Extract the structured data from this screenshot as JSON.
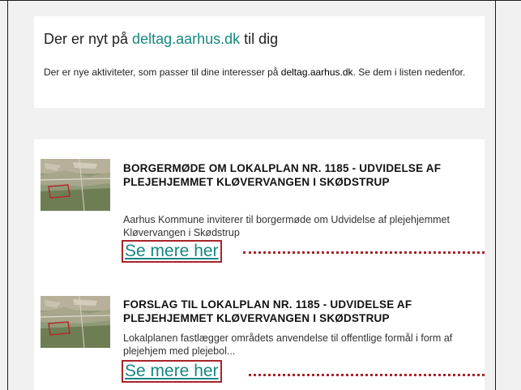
{
  "intro": {
    "title_prefix": "Der er nyt på ",
    "title_link": "deltag.aarhus.dk",
    "title_suffix": " til dig",
    "text_before": "Der er nye aktiviteter, som passer til dine interesser på ",
    "text_bold": "deltag.aarhus.dk",
    "text_after": ". Se dem i listen nedenfor."
  },
  "items": [
    {
      "title": "BORGERMØDE OM LOKALPLAN NR. 1185 - UDVIDELSE AF PLEJEHJEMMET KLØVERVANGEN I SKØDSTRUP",
      "description": "Aarhus Kommune inviterer til borgermøde om Udvidelse af plejehjemmet Kløvervangen i Skødstrup",
      "link_label": "Se mere her"
    },
    {
      "title": "FORSLAG TIL LOKALPLAN NR. 1185 - UDVIDELSE AF PLEJEHJEMMET KLØVERVANGEN I SKØDSTRUP",
      "description": "Lokalplanen fastlægger områdets anvendelse til offentlige formål i form af plejehjem med plejebol...",
      "link_label": "Se mere her"
    }
  ],
  "colors": {
    "link": "#15877f",
    "highlight": "#a8242a",
    "background": "#f1f1f1"
  }
}
